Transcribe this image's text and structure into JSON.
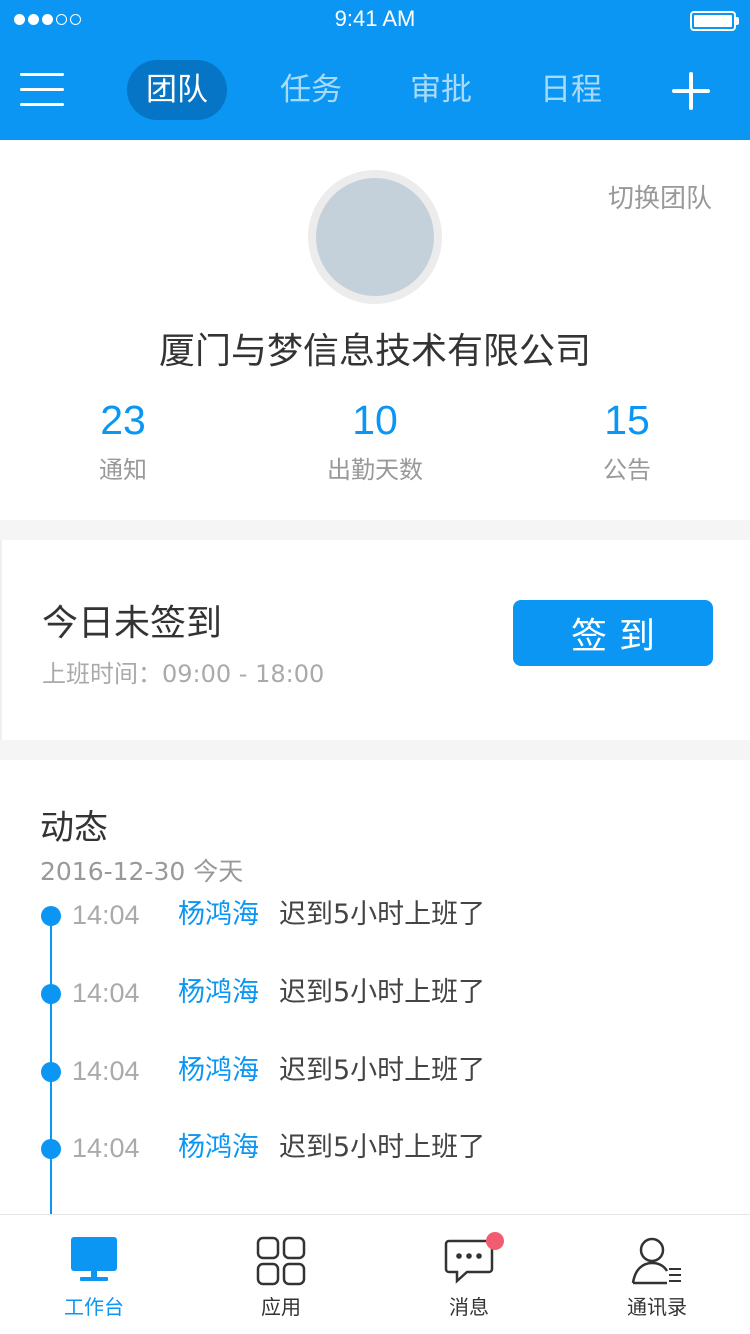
{
  "status_bar": {
    "time": "9:41 AM",
    "signal_icon": "signal-dots-icon",
    "battery_icon": "battery-icon"
  },
  "header": {
    "menu_icon": "menu-icon",
    "tabs": [
      {
        "label": "团队",
        "active": true
      },
      {
        "label": "任务",
        "active": false
      },
      {
        "label": "审批",
        "active": false
      },
      {
        "label": "日程",
        "active": false
      }
    ],
    "add_icon": "plus-icon"
  },
  "team": {
    "switch_label": "切换团队",
    "company_name": "厦门与梦信息技术有限公司",
    "stats": [
      {
        "value": "23",
        "label": "通知"
      },
      {
        "value": "10",
        "label": "出勤天数"
      },
      {
        "value": "15",
        "label": "公告"
      }
    ]
  },
  "checkin": {
    "title": "今日未签到",
    "hours": "上班时间：09:00 - 18:00",
    "button_label": "签到"
  },
  "activity": {
    "title": "动态",
    "date": "2016-12-30 今天",
    "items": [
      {
        "time": "14:04",
        "user": "杨鸿海",
        "text": "迟到5小时上班了"
      },
      {
        "time": "14:04",
        "user": "杨鸿海",
        "text": "迟到5小时上班了"
      },
      {
        "time": "14:04",
        "user": "杨鸿海",
        "text": "迟到5小时上班了"
      },
      {
        "time": "14:04",
        "user": "杨鸿海",
        "text": "迟到5小时上班了"
      }
    ]
  },
  "tabbar": {
    "items": [
      {
        "label": "工作台",
        "icon": "monitor-icon",
        "active": true
      },
      {
        "label": "应用",
        "icon": "apps-grid-icon",
        "active": false
      },
      {
        "label": "消息",
        "icon": "chat-bubble-icon",
        "active": false,
        "badge": true
      },
      {
        "label": "通讯录",
        "icon": "contacts-icon",
        "active": false
      }
    ]
  },
  "colors": {
    "primary": "#0b96f3",
    "header_active_tab": "#0675c6",
    "badge": "#f25c70"
  }
}
